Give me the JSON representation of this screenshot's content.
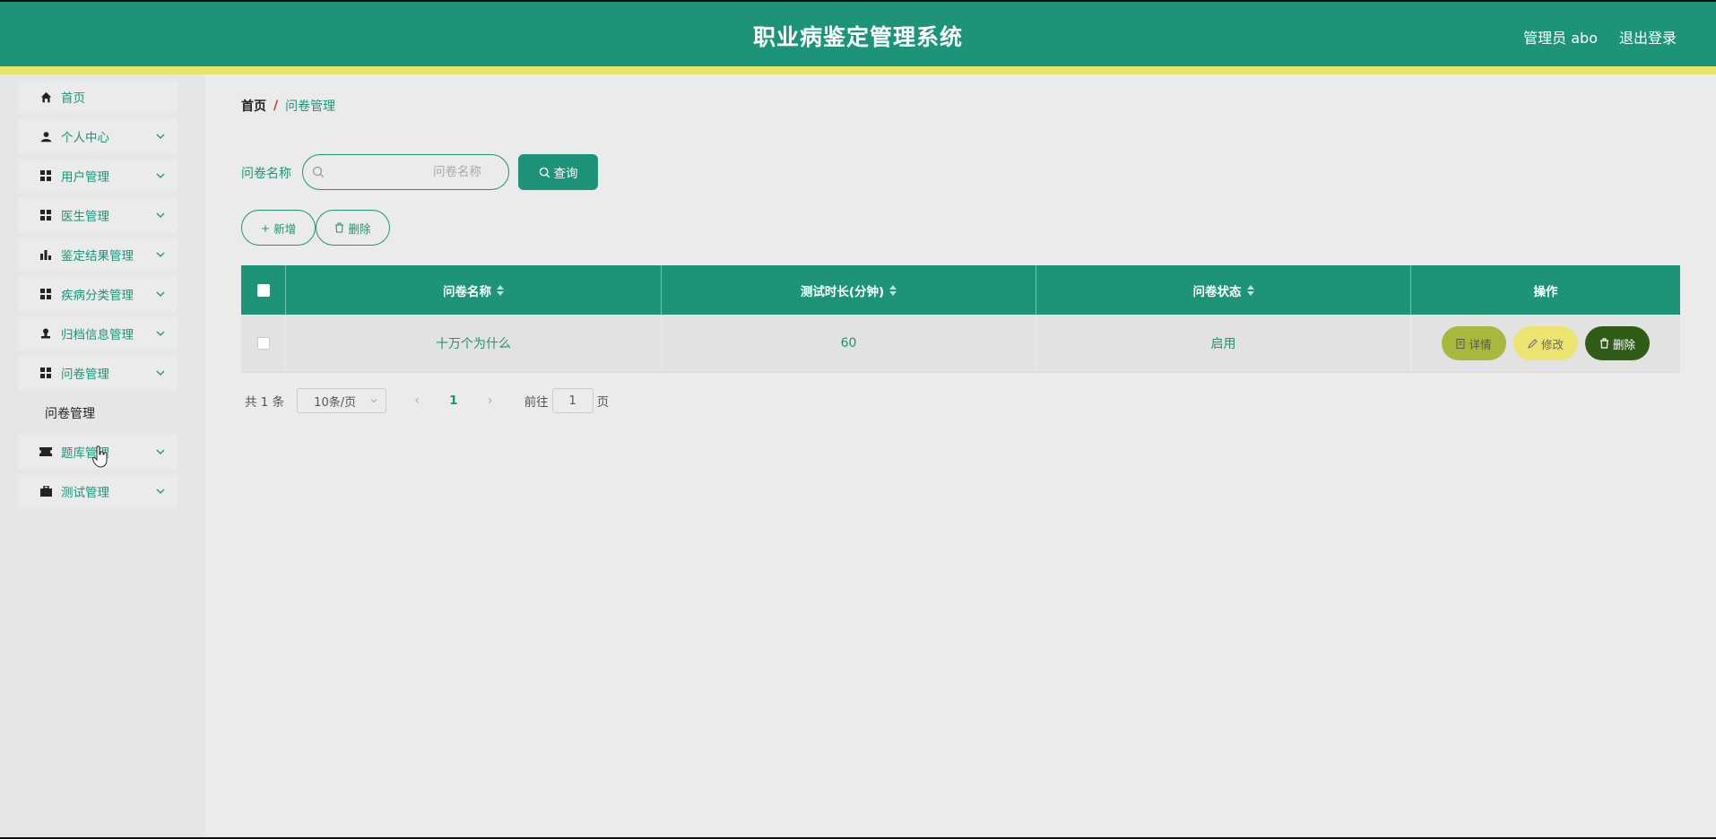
{
  "header": {
    "title": "职业病鉴定管理系统",
    "user_label": "管理员 abo",
    "logout_label": "退出登录"
  },
  "colors": {
    "primary": "#1d9479",
    "accent_stripe": "#e8e46b",
    "detail_btn": "#a8b83c",
    "edit_btn": "#ece470",
    "delete_btn": "#2f5d18"
  },
  "sidebar": {
    "items": [
      {
        "label": "首页",
        "icon": "home-icon"
      },
      {
        "label": "个人中心",
        "icon": "user-icon"
      },
      {
        "label": "用户管理",
        "icon": "grid-icon"
      },
      {
        "label": "医生管理",
        "icon": "grid-icon"
      },
      {
        "label": "鉴定结果管理",
        "icon": "bar-chart-icon"
      },
      {
        "label": "疾病分类管理",
        "icon": "grid-icon"
      },
      {
        "label": "归档信息管理",
        "icon": "stamp-icon"
      },
      {
        "label": "问卷管理",
        "icon": "grid-icon"
      },
      {
        "label": "题库管理",
        "icon": "ticket-icon"
      },
      {
        "label": "测试管理",
        "icon": "briefcase-icon"
      }
    ],
    "submenu_label": "问卷管理"
  },
  "breadcrumb": {
    "home": "首页",
    "separator": "/",
    "current": "问卷管理"
  },
  "search": {
    "label": "问卷名称",
    "placeholder": "问卷名称",
    "value": "",
    "button_label": "查询"
  },
  "actions": {
    "add_label": "新增",
    "delete_label": "删除"
  },
  "table": {
    "columns": [
      "问卷名称",
      "测试时长(分钟)",
      "问卷状态",
      "操作"
    ],
    "rows": [
      {
        "name": "十万个为什么",
        "duration": "60",
        "status": "启用"
      }
    ],
    "row_actions": {
      "detail": "详情",
      "edit": "修改",
      "delete": "删除"
    }
  },
  "pagination": {
    "total": "共 1 条",
    "page_size": "10条/页",
    "current_page": "1",
    "goto_label": "前往",
    "goto_value": "1",
    "goto_suffix": "页"
  }
}
